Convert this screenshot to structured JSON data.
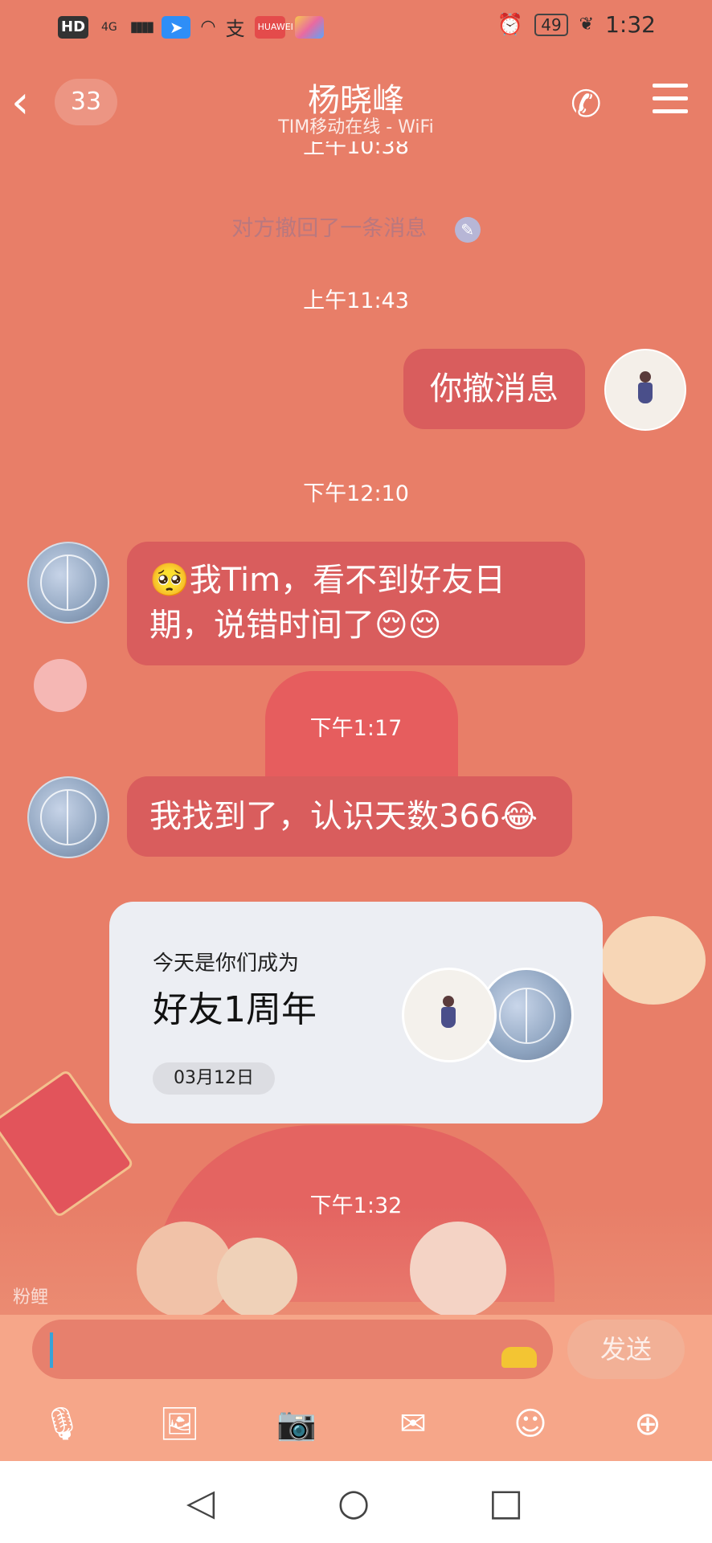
{
  "status_bar": {
    "hd": "HD",
    "network": "4G",
    "signal": "▮▮▮▮",
    "app_icons": [
      "fly-icon",
      "wifi-icon",
      "alipay-icon",
      "huawei-icon",
      "multi-icon"
    ],
    "alipay_glyph": "支",
    "huawei_text": "HUAWEI",
    "battery": "49",
    "time": "1:32"
  },
  "header": {
    "unread_count": "33",
    "title": "杨晓峰",
    "subtitle": "TIM移动在线 - WiFi"
  },
  "messages": {
    "time_partial": "上午10:38",
    "recall_notice": "对方撤回了一条消息",
    "time_1": "上午11:43",
    "msg_me_1": "你撤消息",
    "time_2": "下午12:10",
    "msg_other_1_line1": "🥺我Tim，看不到好友日",
    "msg_other_1_line2": "期，说错时间了😌😌",
    "time_3": "下午1:17",
    "msg_other_2": "我找到了，认识天数366😂",
    "time_4": "下午1:32"
  },
  "card": {
    "line1": "今天是你们成为",
    "line2": "好友1周年",
    "date": "03月12日"
  },
  "decor_label": "粉鲤",
  "input": {
    "value": "",
    "send_label": "发送"
  },
  "toolbar": {
    "icons": [
      "microphone-icon",
      "image-icon",
      "camera-icon",
      "red-packet-icon",
      "emoji-icon",
      "plus-icon"
    ]
  },
  "colors": {
    "background": "#e87e68",
    "bubble": "#d95d5d",
    "accent_caret": "#38a3d8"
  }
}
